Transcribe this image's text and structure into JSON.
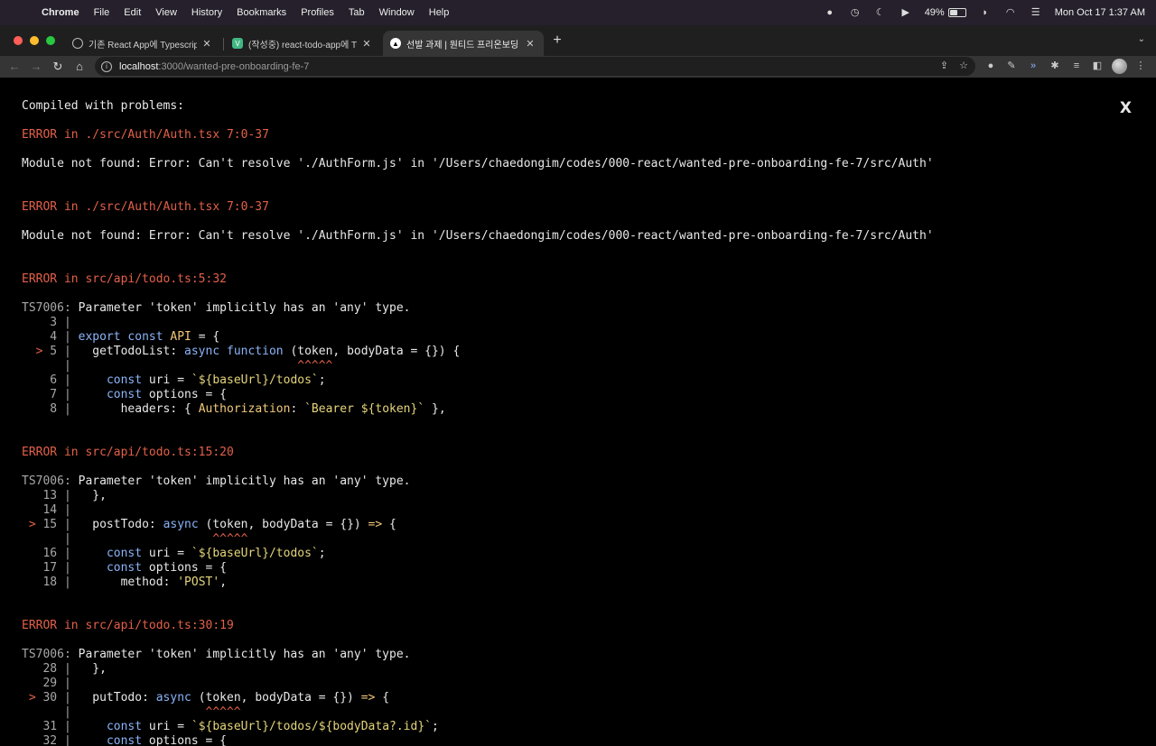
{
  "menubar": {
    "app": "Chrome",
    "items": [
      "File",
      "Edit",
      "View",
      "History",
      "Bookmarks",
      "Profiles",
      "Tab",
      "Window",
      "Help"
    ],
    "battery_pct": "49%",
    "battery_level": 0.49,
    "clock": "Mon Oct 17  1:37 AM"
  },
  "tabs": [
    {
      "title": "기존 React App에 Typescript 적용",
      "favicon": "globe-icon",
      "active": false
    },
    {
      "title": "(작성중) react-todo-app에 Typescript",
      "favicon": "vue-icon",
      "active": false
    },
    {
      "title": "선발 과제 | 원티드 프리온보딩 FE",
      "favicon": "notion-icon",
      "active": true
    }
  ],
  "address": {
    "host": "localhost",
    "path": ":3000/wanted-pre-onboarding-fe-7"
  },
  "overlay": {
    "heading": "Compiled with problems:",
    "close": "X",
    "errors": [
      {
        "title": "ERROR in ./src/Auth/Auth.tsx 7:0-37",
        "message": "Module not found: Error: Can't resolve './AuthForm.js' in '/Users/chaedongim/codes/000-react/wanted-pre-onboarding-fe-7/src/Auth'"
      },
      {
        "title": "ERROR in ./src/Auth/Auth.tsx 7:0-37",
        "message": "Module not found: Error: Can't resolve './AuthForm.js' in '/Users/chaedongim/codes/000-react/wanted-pre-onboarding-fe-7/src/Auth'"
      },
      {
        "title": "ERROR in src/api/todo.ts:5:32",
        "code": "TS7006:",
        "message": "Parameter 'token' implicitly has an 'any' type."
      },
      {
        "title": "ERROR in src/api/todo.ts:15:20",
        "code": "TS7006:",
        "message": "Parameter 'token' implicitly has an 'any' type."
      },
      {
        "title": "ERROR in src/api/todo.ts:30:19",
        "code": "TS7006:",
        "message": "Parameter 'token' implicitly has an 'any' type."
      }
    ],
    "frames": [
      [
        {
          "gutter": "    3 |",
          "code": ""
        },
        {
          "gutter": "    4 |",
          "code": " export const API = {"
        },
        {
          "gutter": "  > 5 |",
          "code": "   getTodoList: async function (token, bodyData = {}) {",
          "marker": true
        },
        {
          "gutter": "      |",
          "code": "                                ^^^^^",
          "caret": true
        },
        {
          "gutter": "    6 |",
          "code": "     const uri = `${baseUrl}/todos`;"
        },
        {
          "gutter": "    7 |",
          "code": "     const options = {"
        },
        {
          "gutter": "    8 |",
          "code": "       headers: { Authorization: `Bearer ${token}` },"
        }
      ],
      [
        {
          "gutter": "   13 |",
          "code": "   },"
        },
        {
          "gutter": "   14 |",
          "code": ""
        },
        {
          "gutter": " > 15 |",
          "code": "   postTodo: async (token, bodyData = {}) => {",
          "marker": true
        },
        {
          "gutter": "      |",
          "code": "                    ^^^^^",
          "caret": true
        },
        {
          "gutter": "   16 |",
          "code": "     const uri = `${baseUrl}/todos`;"
        },
        {
          "gutter": "   17 |",
          "code": "     const options = {"
        },
        {
          "gutter": "   18 |",
          "code": "       method: 'POST',"
        }
      ],
      [
        {
          "gutter": "   28 |",
          "code": "   },"
        },
        {
          "gutter": "   29 |",
          "code": ""
        },
        {
          "gutter": " > 30 |",
          "code": "   putTodo: async (token, bodyData = {}) => {",
          "marker": true
        },
        {
          "gutter": "      |",
          "code": "                   ^^^^^",
          "caret": true
        },
        {
          "gutter": "   31 |",
          "code": "     const uri = `${baseUrl}/todos/${bodyData?.id}`;"
        },
        {
          "gutter": "   32 |",
          "code": "     const options = {"
        }
      ]
    ]
  },
  "colors": {
    "error": "#e36049",
    "keyword": "#8ab4f8",
    "string": "#e5d57a",
    "background": "#000000"
  }
}
